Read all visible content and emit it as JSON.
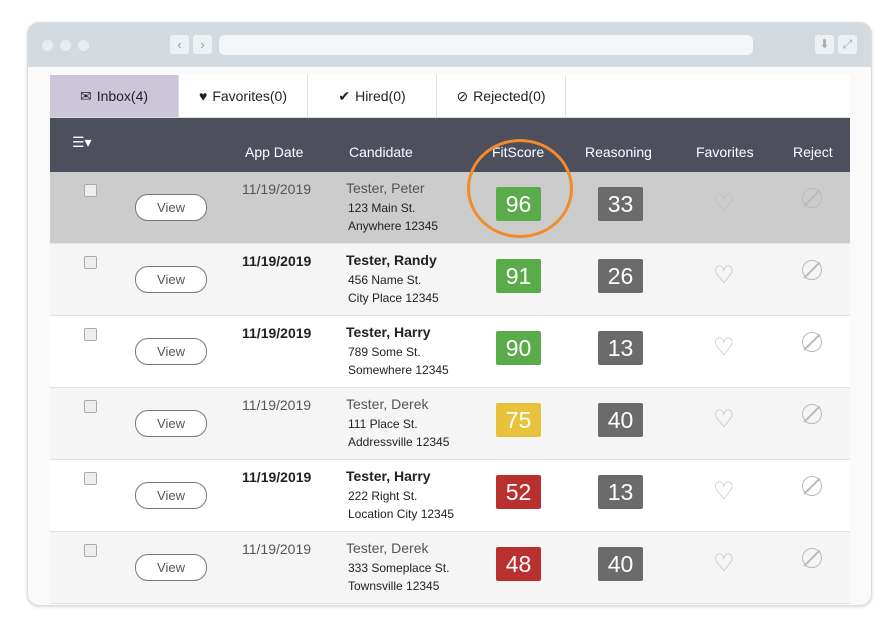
{
  "tabs": [
    {
      "label": "Inbox(4)",
      "icon": "envelope-icon"
    },
    {
      "label": "Favorites(0)",
      "icon": "heart-icon"
    },
    {
      "label": "Hired(0)",
      "icon": "check-icon"
    },
    {
      "label": "Rejected(0)",
      "icon": "ban-icon"
    }
  ],
  "columns": {
    "app_date": "App Date",
    "candidate": "Candidate",
    "fitscore": "FitScore",
    "reasoning": "Reasoning",
    "favorites": "Favorites",
    "reject": "Reject"
  },
  "view_label": "View",
  "colors": {
    "green": "#5aab4a",
    "yellow": "#e8c23a",
    "red": "#b8312f",
    "highlight": "#f08c2a"
  },
  "rows": [
    {
      "date": "11/19/2019",
      "name": "Tester, Peter",
      "addr1": "123 Main St.",
      "addr2": "Anywhere 12345",
      "fit": "96",
      "reason": "33",
      "color": "#5aab4a",
      "bold": false
    },
    {
      "date": "11/19/2019",
      "name": "Tester, Randy",
      "addr1": "456 Name St.",
      "addr2": "City Place 12345",
      "fit": "91",
      "reason": "26",
      "color": "#5aab4a",
      "bold": true
    },
    {
      "date": "11/19/2019",
      "name": "Tester, Harry",
      "addr1": "789 Some St.",
      "addr2": "Somewhere 12345",
      "fit": "90",
      "reason": "13",
      "color": "#5aab4a",
      "bold": true
    },
    {
      "date": "11/19/2019",
      "name": "Tester, Derek",
      "addr1": "111 Place St.",
      "addr2": "Addressville 12345",
      "fit": "75",
      "reason": "40",
      "color": "#e8c23a",
      "bold": false
    },
    {
      "date": "11/19/2019",
      "name": "Tester, Harry",
      "addr1": "222 Right St.",
      "addr2": "Location City 12345",
      "fit": "52",
      "reason": "13",
      "color": "#b8312f",
      "bold": true
    },
    {
      "date": "11/19/2019",
      "name": "Tester, Derek",
      "addr1": "333 Someplace St.",
      "addr2": "Townsville 12345",
      "fit": "48",
      "reason": "40",
      "color": "#b8312f",
      "bold": false
    }
  ]
}
